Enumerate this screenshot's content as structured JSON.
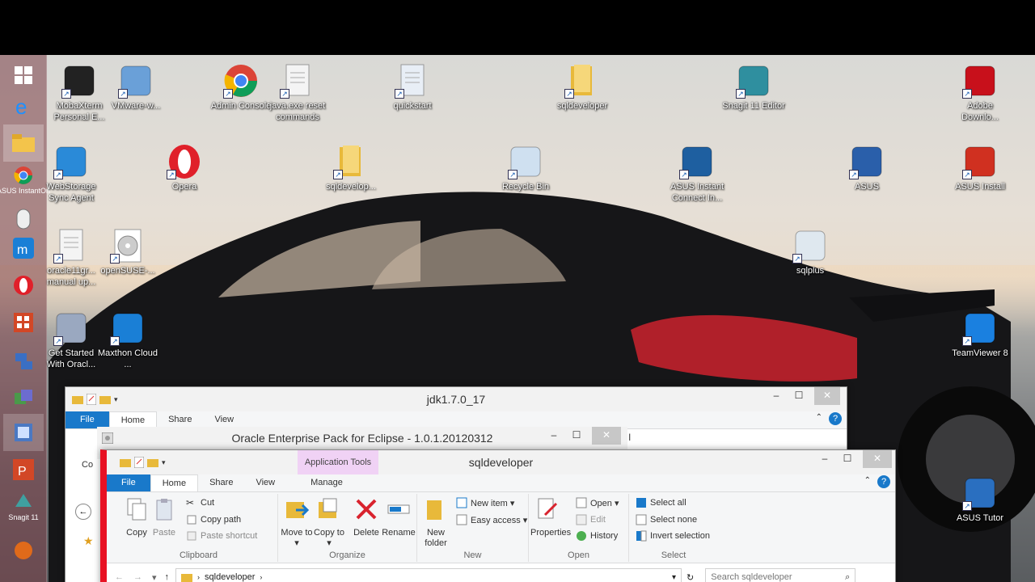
{
  "desktop": {
    "icons": [
      {
        "label": "MobaXterm Personal E...",
        "icon": "terminal-icon"
      },
      {
        "label": "VMware-w...",
        "icon": "vmware-icon"
      },
      {
        "label": "Admin Console",
        "icon": "chrome-icon"
      },
      {
        "label": "java.exe reset commands",
        "icon": "document-icon"
      },
      {
        "label": "quickstart",
        "icon": "settings-document-icon"
      },
      {
        "label": "sqldeveloper",
        "icon": "folder-icon"
      },
      {
        "label": "Snagit 11 Editor",
        "icon": "snagit-icon"
      },
      {
        "label": "Adobe Downlo...",
        "icon": "adobe-icon"
      },
      {
        "label": "WebStorage Sync Agent",
        "icon": "webstorage-icon"
      },
      {
        "label": "Opera",
        "icon": "opera-icon"
      },
      {
        "label": "sqldevelop...",
        "icon": "folder-icon"
      },
      {
        "label": "Recycle Bin",
        "icon": "recycle-bin-icon"
      },
      {
        "label": "ASUS Instant Connect In...",
        "icon": "asus-instant-connect-icon"
      },
      {
        "label": "ASUS",
        "icon": "asus-icon"
      },
      {
        "label": "ASUS Install",
        "icon": "asus-install-icon"
      },
      {
        "label": "oracle11gr... manual up...",
        "icon": "document-icon"
      },
      {
        "label": "openSUSE-...",
        "icon": "disc-icon"
      },
      {
        "label": "sqlplus",
        "icon": "sqlplus-icon"
      },
      {
        "label": "Get Started With Oracl...",
        "icon": "oracle-db-icon"
      },
      {
        "label": "Maxthon Cloud ...",
        "icon": "maxthon-icon"
      },
      {
        "label": "TeamViewer 8",
        "icon": "teamviewer-icon"
      },
      {
        "label": "ASUS Tutor",
        "icon": "asus-tutor-icon"
      }
    ],
    "taskbar_labels": {
      "instant_on": "ASUS InstantOn",
      "snagit": "Snagit 11"
    }
  },
  "windows": {
    "jdk": {
      "title": "jdk1.7.0_17",
      "tabs": [
        "File",
        "Home",
        "Share",
        "View"
      ],
      "copy_partial": "Co",
      "k_partial": "l"
    },
    "eclipse": {
      "title": "Oracle Enterprise Pack for Eclipse - 1.0.1.20120312"
    },
    "sqldev": {
      "title": "sqldeveloper",
      "context_tab": "Application Tools",
      "tabs": [
        "File",
        "Home",
        "Share",
        "View",
        "Manage"
      ],
      "clipboard": {
        "copy": "Copy",
        "paste": "Paste",
        "cut": "Cut",
        "copy_path": "Copy path",
        "paste_shortcut": "Paste shortcut",
        "label": "Clipboard"
      },
      "organize": {
        "move_to": "Move to ▾",
        "copy_to": "Copy to ▾",
        "delete": "Delete",
        "rename": "Rename",
        "label": "Organize"
      },
      "new": {
        "new_folder": "New folder",
        "new_item": "New item ▾",
        "easy_access": "Easy access ▾",
        "label": "New"
      },
      "open": {
        "properties": "Properties",
        "open": "Open ▾",
        "edit": "Edit",
        "history": "History",
        "label": "Open"
      },
      "select": {
        "select_all": "Select all",
        "select_none": "Select none",
        "invert": "Invert selection",
        "label": "Select"
      },
      "address": {
        "crumb": "sqldeveloper",
        "search_placeholder": "Search sqldeveloper"
      }
    }
  },
  "colors": {
    "file_tab": "#1979ca",
    "context_tab": "#f0d2f5"
  }
}
